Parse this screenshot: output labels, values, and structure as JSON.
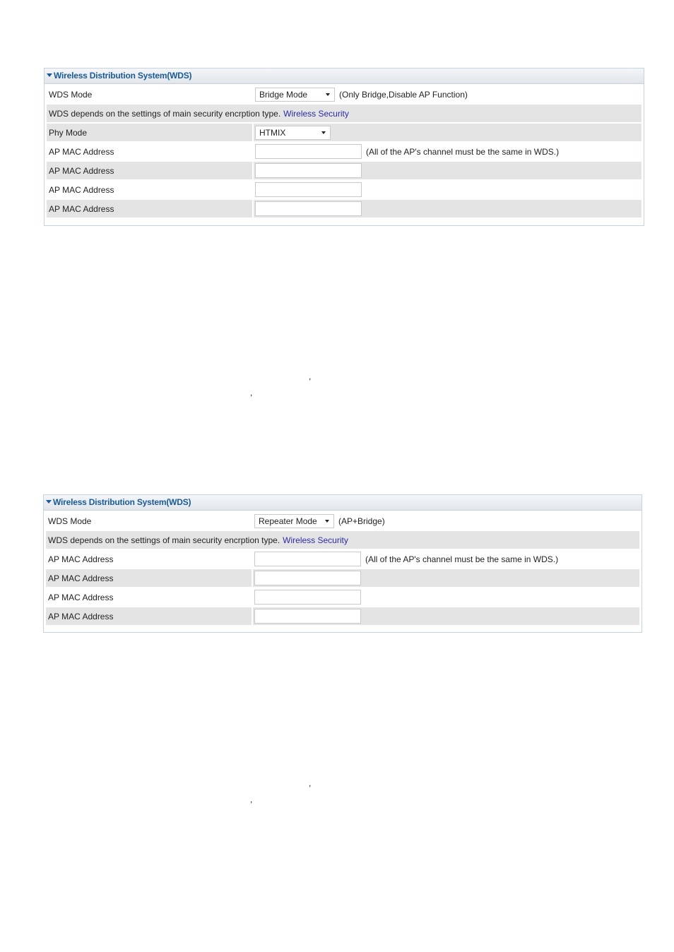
{
  "panels": [
    {
      "title": "Wireless Distribution System(WDS)",
      "wds_mode_label": "WDS Mode",
      "wds_mode_value": "Bridge Mode",
      "wds_mode_note": "(Only Bridge,Disable AP Function)",
      "security_text": "WDS depends on the settings of main security encrption type.",
      "security_link": "Wireless Security",
      "phy_mode_label": "Phy Mode",
      "phy_mode_value": "HTMIX",
      "mac_label": "AP MAC Address",
      "mac_note": "(All of the AP's channel must be the same in WDS.)",
      "mac_values": [
        "",
        "",
        "",
        ""
      ]
    },
    {
      "title": "Wireless Distribution System(WDS)",
      "wds_mode_label": "WDS Mode",
      "wds_mode_value": "Repeater Mode",
      "wds_mode_note": "(AP+Bridge)",
      "security_text": "WDS depends on the settings of main security encrption type.",
      "security_link": "Wireless Security",
      "mac_label": "AP MAC Address",
      "mac_note": "(All of the AP's channel must be the same in WDS.)",
      "mac_values": [
        "",
        "",
        "",
        ""
      ]
    }
  ],
  "stray_marks": [
    ",",
    ",",
    ",",
    ","
  ]
}
